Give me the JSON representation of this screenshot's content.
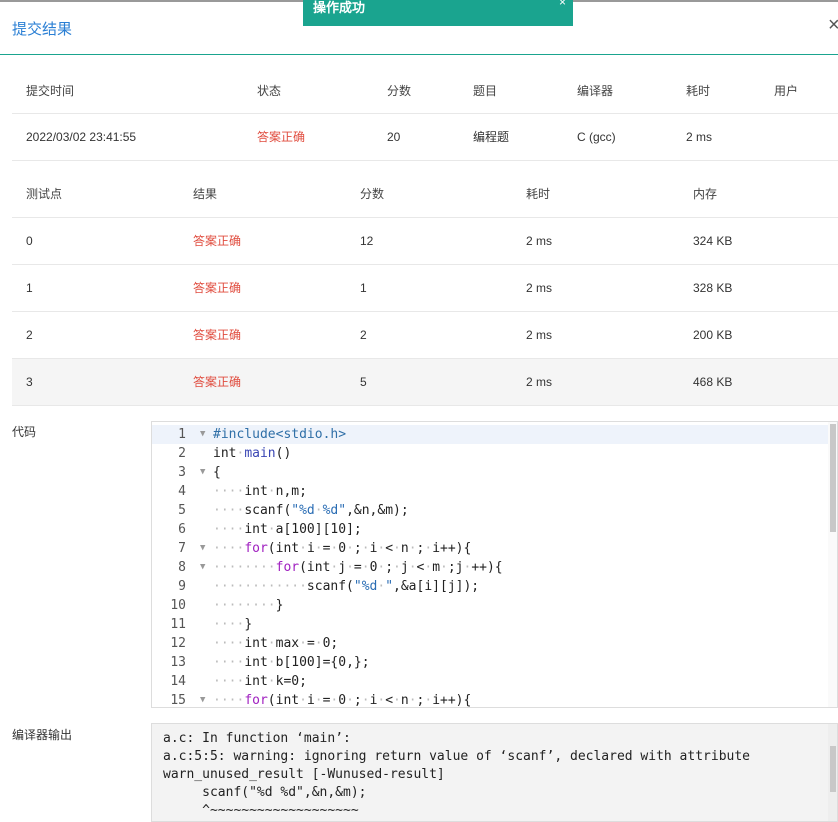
{
  "toast": {
    "text": "操作成功",
    "close": "×"
  },
  "dialog": {
    "title": "提交结果",
    "close": "×"
  },
  "submission": {
    "headers": [
      "提交时间",
      "状态",
      "分数",
      "题目",
      "编译器",
      "耗时",
      "用户"
    ],
    "row": {
      "time": "2022/03/02 23:41:55",
      "status": "答案正确",
      "score": "20",
      "problem": "编程题",
      "compiler": "C (gcc)",
      "elapsed": "2 ms",
      "user": ""
    }
  },
  "testcases": {
    "headers": [
      "测试点",
      "结果",
      "分数",
      "耗时",
      "内存"
    ],
    "rows": [
      {
        "id": "0",
        "result": "答案正确",
        "score": "12",
        "time": "2 ms",
        "memory": "324 KB"
      },
      {
        "id": "1",
        "result": "答案正确",
        "score": "1",
        "time": "2 ms",
        "memory": "328 KB"
      },
      {
        "id": "2",
        "result": "答案正确",
        "score": "2",
        "time": "2 ms",
        "memory": "200 KB"
      },
      {
        "id": "3",
        "result": "答案正确",
        "score": "5",
        "time": "2 ms",
        "memory": "468 KB"
      }
    ]
  },
  "code": {
    "label": "代码",
    "lines": [
      "#include<stdio.h>",
      "int·main()",
      "{",
      "····int·n,m;",
      "····scanf(\"%d·%d\",&n,&m);",
      "····int·a[100][10];",
      "····for(int·i·=·0·;·i·<·n·;·i++){",
      "········for(int·j·=·0·;·j·<·m·;j·++){",
      "············scanf(\"%d·\",&a[i][j]);",
      "········}",
      "····}",
      "····int·max·=·0;",
      "····int·b[100]={0,};",
      "····int·k=0;",
      "····for(int·i·=·0·;·i·<·n·;·i++){"
    ]
  },
  "compiler_output": {
    "label": "编译器输出",
    "text": "a.c: In function ‘main’:\na.c:5:5: warning: ignoring return value of ‘scanf’, declared with attribute\nwarn_unused_result [-Wunused-result]\n     scanf(\"%d %d\",&n,&m);\n     ^~~~~~~~~~~~~~~~~~~~\n"
  }
}
